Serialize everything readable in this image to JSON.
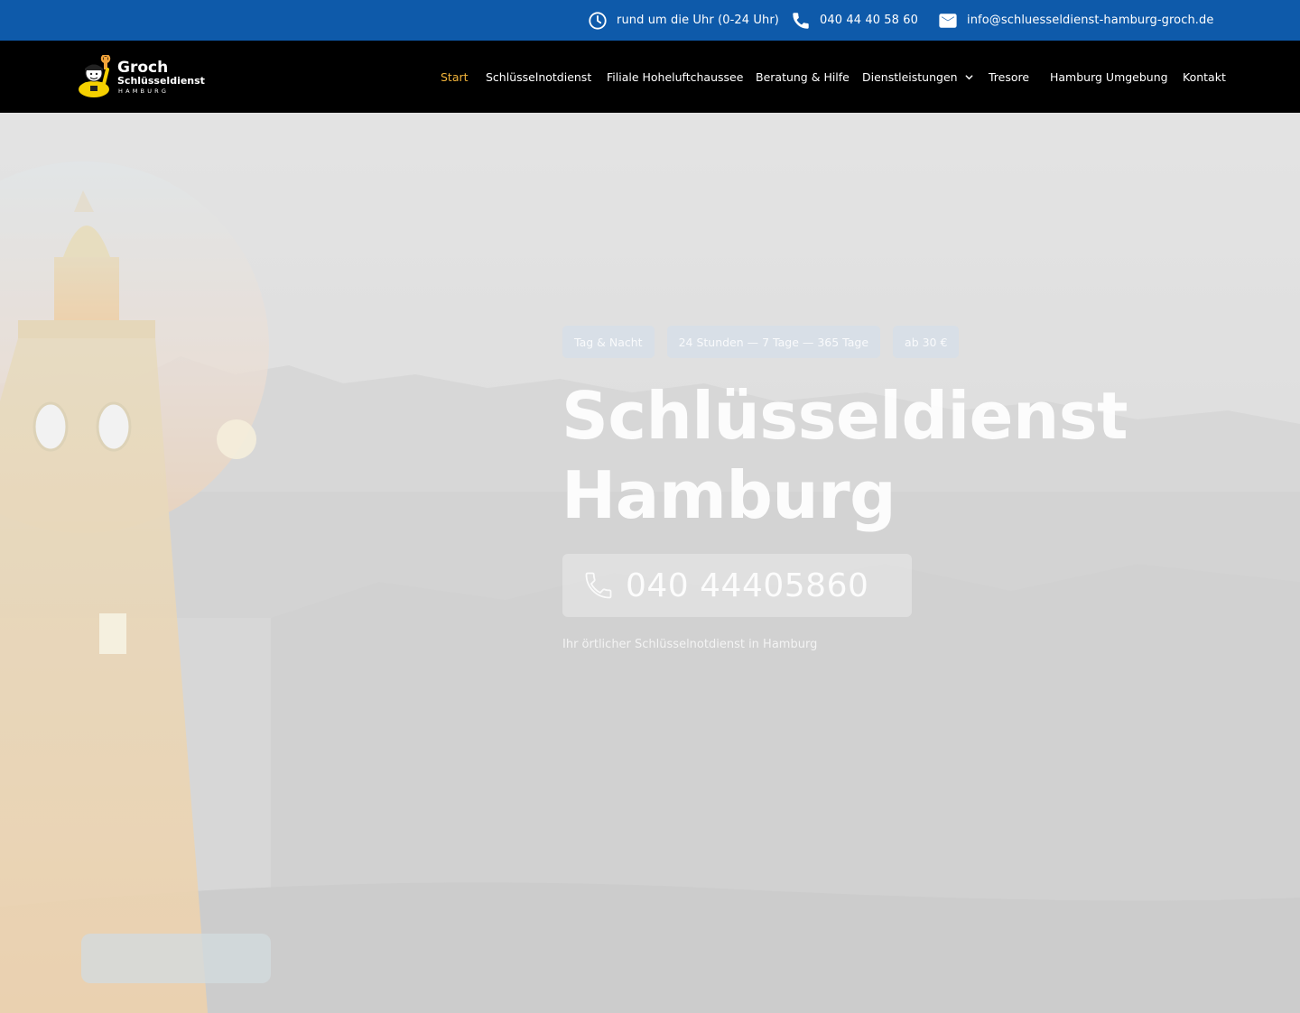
{
  "topbar": {
    "hours": "rund um die Uhr (0-24 Uhr)",
    "phone": "040 44 40 58 60",
    "email": "info@schluesseldienst-hamburg-groch.de"
  },
  "logo": {
    "name": "Groch",
    "subtitle": "Schlüsseldienst",
    "city": "HAMBURG"
  },
  "nav": {
    "items": [
      {
        "label": "Start"
      },
      {
        "label": "Schlüsselnotdienst"
      },
      {
        "label": "Filiale Hoheluftchaussee"
      },
      {
        "label": "Beratung & Hilfe"
      },
      {
        "label": "Dienstleistungen"
      },
      {
        "label": "Tresore"
      },
      {
        "label": "Hamburg Umgebung"
      },
      {
        "label": "Kontakt"
      }
    ]
  },
  "hero": {
    "badges": [
      "Tag & Nacht",
      "24 Stunden — 7 Tage — 365 Tage",
      "ab 30 €"
    ],
    "title_line1": "Schlüsseldienst",
    "title_line2": "Hamburg",
    "call_number": "040 44405860",
    "subtitle": "Ihr örtlicher Schlüsselnotdienst in Hamburg"
  },
  "colors": {
    "topbar": "#0e5aaa",
    "header": "#000000",
    "nav_active": "#f2b43a",
    "nav_text": "#ffffff"
  },
  "icons": {
    "hours": "clock-icon",
    "phone": "phone-icon",
    "email": "mail-icon",
    "dropdown": "chevron-down-icon"
  }
}
